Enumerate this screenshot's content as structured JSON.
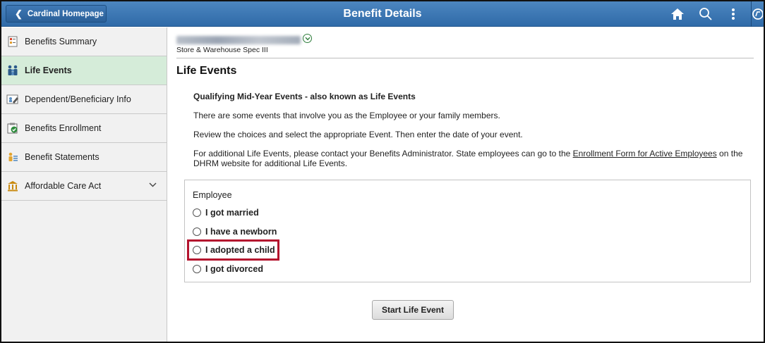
{
  "header": {
    "back_label": "Cardinal Homepage",
    "title": "Benefit Details",
    "icons": [
      "home-icon",
      "search-icon",
      "more-options-icon",
      "navigation-icon"
    ]
  },
  "sidebar": {
    "items": [
      {
        "label": "Benefits Summary",
        "icon": "benefits-summary-icon",
        "active": false
      },
      {
        "label": "Life Events",
        "icon": "family-icon",
        "active": true
      },
      {
        "label": "Dependent/Beneficiary Info",
        "icon": "dependent-icon",
        "active": false
      },
      {
        "label": "Benefits Enrollment",
        "icon": "enrollment-icon",
        "active": false
      },
      {
        "label": "Benefit Statements",
        "icon": "statements-icon",
        "active": false
      },
      {
        "label": "Affordable Care Act",
        "icon": "building-icon",
        "active": false,
        "expandable": true
      }
    ]
  },
  "employee": {
    "job_title": "Store & Warehouse Spec III"
  },
  "main": {
    "section_title": "Life Events",
    "qualifying_title": "Qualifying Mid-Year Events - also known as Life Events",
    "para1": "There are some events that involve you as the Employee or your family members.",
    "para2": "Review the choices and select the appropriate Event. Then enter the date of your event.",
    "para3_before": "For additional Life Events, please contact your Benefits Administrator. State employees can go to the ",
    "para3_link": "Enrollment Form for Active Employees",
    "para3_after": " on the DHRM website for additional Life Events.",
    "group_label": "Employee",
    "options": [
      {
        "label": "I got married",
        "selected": false
      },
      {
        "label": "I have a newborn",
        "selected": false
      },
      {
        "label": "I adopted a child",
        "selected": false,
        "highlighted": true
      },
      {
        "label": "I got divorced",
        "selected": false
      }
    ],
    "start_button": "Start Life Event"
  },
  "colors": {
    "header_bg": "#3a76b4",
    "active_item_bg": "#d5ecd9",
    "highlight_border": "#b4132e"
  }
}
